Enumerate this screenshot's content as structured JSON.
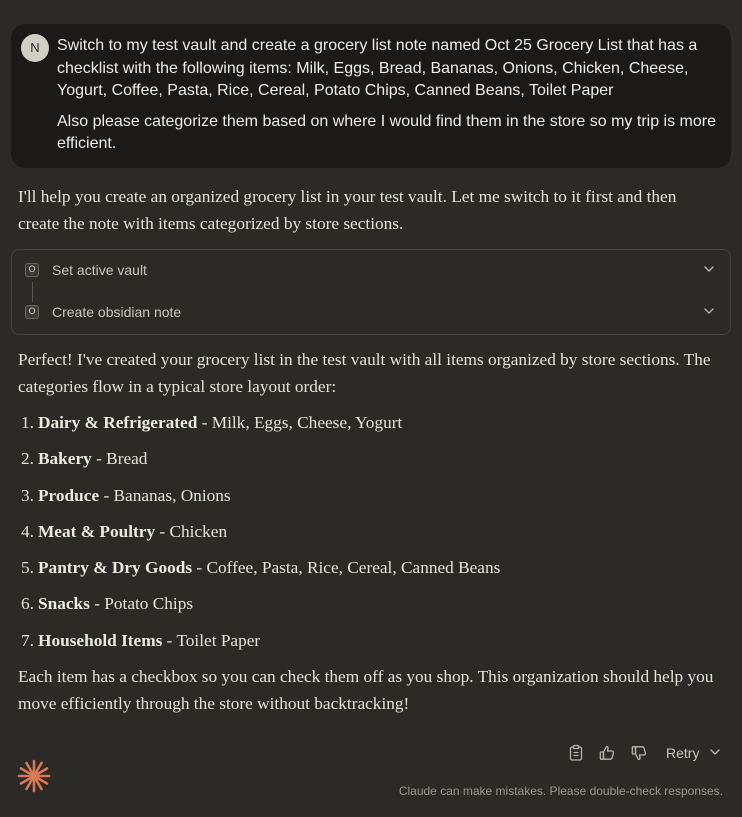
{
  "user_message": {
    "avatar_initial": "N",
    "paragraphs": [
      "Switch to my test vault and create a grocery list note named Oct 25 Grocery List that has a checklist with the following items: Milk, Eggs, Bread, Bananas, Onions, Chicken, Cheese, Yogurt, Coffee, Pasta, Rice, Cereal, Potato Chips, Canned Beans, Toilet Paper",
      "Also please categorize them based on where I would find them in the store so my trip is more efficient."
    ]
  },
  "assistant": {
    "intro": "I'll help you create an organized grocery list in your test vault. Let me switch to it first and then create the note with items categorized by store sections.",
    "tool_calls": [
      {
        "icon": "obsidian-tool-icon",
        "icon_glyph": "O",
        "label": "Set active vault"
      },
      {
        "icon": "obsidian-tool-icon",
        "icon_glyph": "O",
        "label": "Create obsidian note"
      }
    ],
    "response_intro": "Perfect! I've created your grocery list in the test vault with all items organized by store sections. The categories flow in a typical store layout order:",
    "categories": [
      {
        "number": "1.",
        "name": "Dairy & Refrigerated",
        "items": " - Milk, Eggs, Cheese, Yogurt"
      },
      {
        "number": "2.",
        "name": "Bakery",
        "items": " - Bread"
      },
      {
        "number": "3.",
        "name": "Produce",
        "items": " - Bananas, Onions"
      },
      {
        "number": "4.",
        "name": "Meat & Poultry",
        "items": " - Chicken"
      },
      {
        "number": "5.",
        "name": "Pantry & Dry Goods",
        "items": " - Coffee, Pasta, Rice, Cereal, Canned Beans"
      },
      {
        "number": "6.",
        "name": "Snacks",
        "items": " - Potato Chips"
      },
      {
        "number": "7.",
        "name": "Household Items",
        "items": " - Toilet Paper"
      }
    ],
    "closing": "Each item has a checkbox so you can check them off as you shop. This organization should help you move efficiently through the store without backtracking!"
  },
  "actions": {
    "copy_icon": "clipboard-icon",
    "thumbs_up_icon": "thumbs-up-icon",
    "thumbs_down_icon": "thumbs-down-icon",
    "retry_label": "Retry"
  },
  "footer": {
    "disclaimer": "Claude can make mistakes. Please double-check responses."
  },
  "colors": {
    "background": "#2b2a27",
    "user_bubble": "#1b1a18",
    "brand_accent": "#d97757"
  }
}
